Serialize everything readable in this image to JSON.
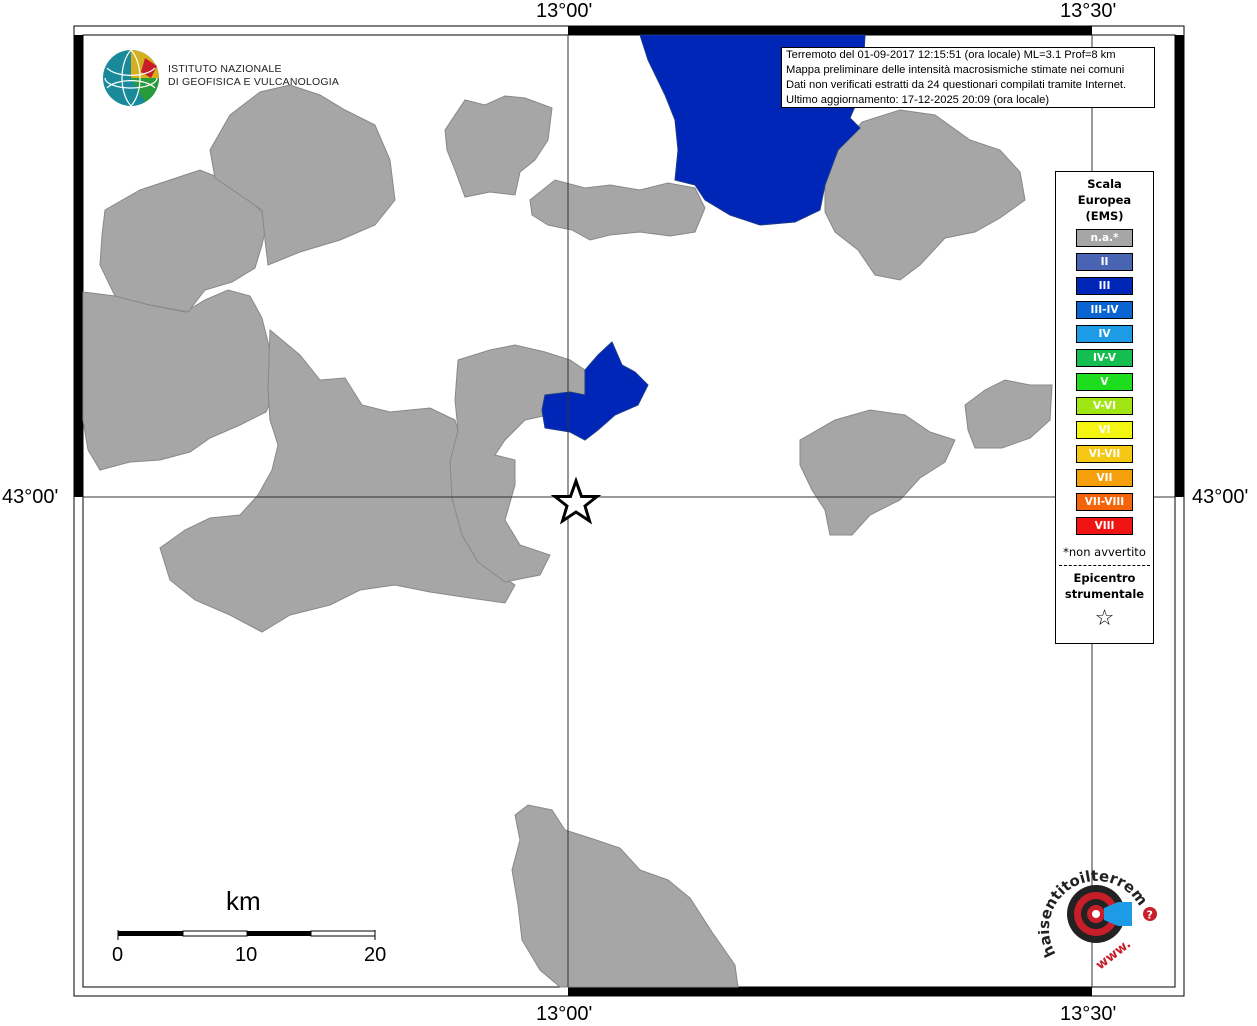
{
  "map": {
    "lon_labels": {
      "left": "13°00'",
      "right": "13°30'"
    },
    "lat_label": "43°00'",
    "colors": {
      "na": "#a6a6a6",
      "III": "#0026b8",
      "frame": "#000000"
    }
  },
  "info": {
    "line1": "Terremoto del 01-09-2017 12:15:51 (ora locale) ML=3.1 Prof=8 km",
    "line2": "Mappa preliminare delle intensità macrosismiche stimate nei comuni",
    "line3": "Dati non verificati estratti da 24 questionari compilati tramite Internet.",
    "line4": "Ultimo aggiornamento: 17-12-2025 20:09 (ora locale)"
  },
  "legend": {
    "title_line1": "Scala",
    "title_line2": "Europea",
    "title_line3": "(EMS)",
    "items": [
      {
        "label": "n.a.*",
        "color": "#a6a6a6"
      },
      {
        "label": "II",
        "color": "#4a64b4"
      },
      {
        "label": "III",
        "color": "#0026b8"
      },
      {
        "label": "III-IV",
        "color": "#0a64d2"
      },
      {
        "label": "IV",
        "color": "#1e9be6"
      },
      {
        "label": "IV-V",
        "color": "#14be50"
      },
      {
        "label": "V",
        "color": "#1edc1e"
      },
      {
        "label": "V-VI",
        "color": "#a0e614"
      },
      {
        "label": "VI",
        "color": "#f5f514"
      },
      {
        "label": "VI-VII",
        "color": "#f5c814"
      },
      {
        "label": "VII",
        "color": "#f5a00a"
      },
      {
        "label": "VII-VIII",
        "color": "#f5640a"
      },
      {
        "label": "VIII",
        "color": "#f01414"
      }
    ],
    "note": "*non avvertito",
    "epicenter_line1": "Epicentro",
    "epicenter_line2": "strumentale",
    "star": "☆"
  },
  "ingv": {
    "name_line1": "ISTITUTO NAZIONALE",
    "name_line2": "DI GEOFISICA E VULCANOLOGIA"
  },
  "scalebar": {
    "unit": "km",
    "ticks": [
      "0",
      "10",
      "20"
    ]
  },
  "hsit": {
    "text": "haisentitoilterremoto.it",
    "www": "www.",
    "q": "?"
  }
}
